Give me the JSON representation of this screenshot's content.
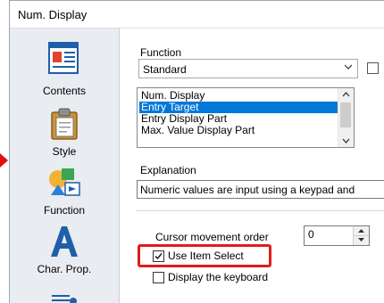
{
  "window": {
    "title": "Num. Display"
  },
  "sidebar": {
    "items": [
      {
        "label": "Contents",
        "icon": "contents-icon"
      },
      {
        "label": "Style",
        "icon": "style-icon"
      },
      {
        "label": "Function",
        "icon": "function-icon",
        "selected": true
      },
      {
        "label": "Char. Prop.",
        "icon": "char-prop-icon"
      }
    ]
  },
  "function_section": {
    "label": "Function",
    "selected": "Standard"
  },
  "list": {
    "items": [
      "Num. Display",
      "Entry Target",
      "Entry Display Part",
      "Max. Value Display Part"
    ],
    "selected_index": 1
  },
  "explanation": {
    "label": "Explanation",
    "text": "Numeric values are input using a keypad and"
  },
  "cursor_order": {
    "label": "Cursor movement order",
    "value": "0"
  },
  "options": {
    "use_item_select": {
      "label": "Use Item Select",
      "checked": true
    },
    "display_keyboard": {
      "label": "Display the keyboard",
      "checked": false
    }
  },
  "colors": {
    "accent_selection": "#0078d7",
    "highlight_frame": "#e01c1c",
    "rail_bg": "#e9ecf1"
  }
}
